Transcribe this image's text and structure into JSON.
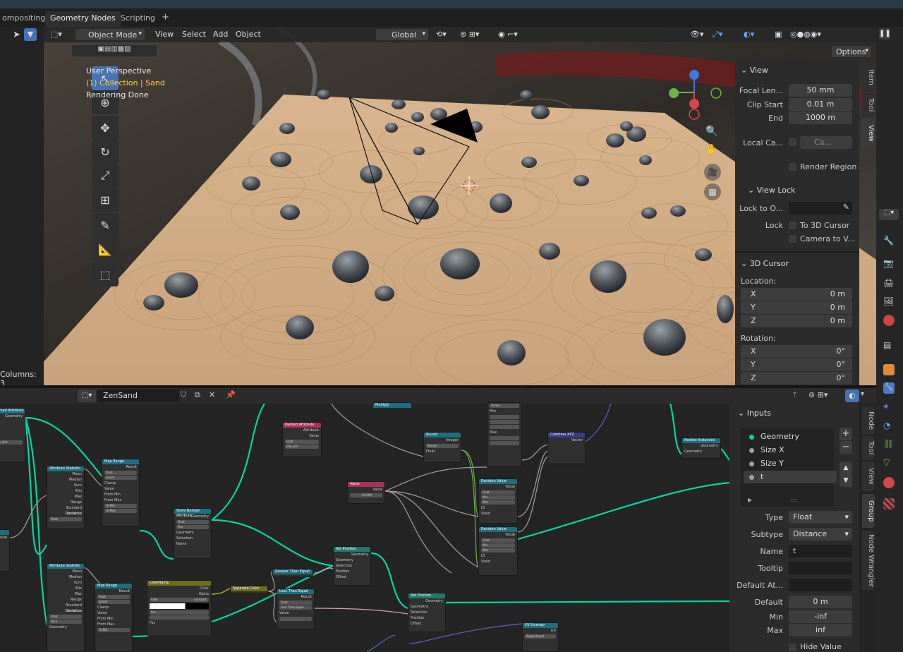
{
  "workspace_tabs": [
    "ompositing",
    "Geometry Nodes",
    "Scripting",
    "+"
  ],
  "viewport": {
    "mode": "Object Mode",
    "menus": [
      "View",
      "Select",
      "Add",
      "Object"
    ],
    "transform_orientation": "Global",
    "options": "Options",
    "overlay_lines": [
      "User Perspective",
      "(1) Collection | Sand",
      "Rendering Done"
    ],
    "columns_label": "Columns: 3"
  },
  "n_panel": {
    "view_header": "View",
    "focal_length": {
      "label": "Focal Len...",
      "value": "50 mm"
    },
    "clip_start": {
      "label": "Clip Start",
      "value": "0.01 m"
    },
    "clip_end": {
      "label": "End",
      "value": "1000 m"
    },
    "local_camera": {
      "label": "Local Ca...",
      "value": "Ca..."
    },
    "render_region": "Render Region",
    "view_lock_header": "View Lock",
    "lock_to_object": "Lock to O...",
    "lock": "Lock",
    "to_3d_cursor": "To 3D Cursor",
    "camera_to_view": "Camera to V...",
    "cursor_header": "3D Cursor",
    "location_label": "Location:",
    "location": [
      {
        "axis": "X",
        "value": "0 m"
      },
      {
        "axis": "Y",
        "value": "0 m"
      },
      {
        "axis": "Z",
        "value": "0 m"
      }
    ],
    "rotation_label": "Rotation:",
    "rotation": [
      {
        "axis": "X",
        "value": "0°"
      },
      {
        "axis": "Y",
        "value": "0°"
      },
      {
        "axis": "Z",
        "value": "0°"
      }
    ],
    "tabs": [
      "Item",
      "Tool",
      "View"
    ]
  },
  "node_editor": {
    "tree_name": "ZenSand",
    "tabs": [
      "Node",
      "Tool",
      "View",
      "Group",
      "Node Wrangler"
    ],
    "group_panel": {
      "header": "Inputs",
      "inputs": [
        {
          "name": "Geometry",
          "color": "#00d6a3"
        },
        {
          "name": "Size X",
          "color": "#a1a1a1"
        },
        {
          "name": "Size Y",
          "color": "#a1a1a1"
        },
        {
          "name": "t",
          "color": "#a1a1a1"
        }
      ],
      "type": {
        "label": "Type",
        "value": "Float"
      },
      "subtype": {
        "label": "Subtype",
        "value": "Distance"
      },
      "name": {
        "label": "Name",
        "value": "t"
      },
      "tooltip": {
        "label": "Tooltip",
        "value": ""
      },
      "default_attr": {
        "label": "Default At...",
        "value": ""
      },
      "default": {
        "label": "Default",
        "value": "0 m"
      },
      "min": {
        "label": "Min",
        "value": "-inf"
      },
      "max": {
        "label": "Max",
        "value": "inf"
      },
      "hide_value": "Hide Value"
    },
    "nodes": {
      "map_range": "Map Range",
      "attribute_statistic": "Attribute Statistic",
      "store_named_attribute": "Store Named Attribute",
      "named_attribute": "Named Attribute",
      "value": "Value",
      "value_amount": "40.000",
      "set_position": "Set Position",
      "round": "Round",
      "random_value": "Random Value",
      "combine_xyz": "Combine XYZ",
      "realize_instances": "Realize Instances",
      "color_ramp": "ColorRamp",
      "separate_color": "Separate Color",
      "greater_than": "Greater Than Equal",
      "less_than": "Less Than Equal",
      "multiply": "Multiply",
      "uv_unwrap": "UV Unwrap",
      "vector": "Vector",
      "labels": {
        "geometry": "Geometry",
        "result": "Result",
        "float": "Float",
        "linear": "Linear",
        "clamp": "Clamp",
        "selection": "Selection",
        "name": "Name",
        "position": "Position",
        "offset": "Offset",
        "value_lbl": "Value",
        "attribute": "Attribute",
        "round_lbl": "Round",
        "integer": "Integer",
        "min": "Min",
        "max": "Max",
        "seed": "Seed",
        "id": "ID",
        "color": "Color",
        "alpha": "Alpha",
        "rgb": "RGB",
        "constant": "Constant",
        "fac": "Fac",
        "pos": "Pos",
        "face": "Face",
        "mean": "Mean",
        "median": "Median",
        "sum": "Sum",
        "range": "Range",
        "std_dev": "Standard Deviation",
        "variance": "Variance",
        "from_min": "From Min",
        "from_max": "From Max",
        "to_min": "To Min",
        "to_max": "To Max",
        "angle_based": "Angle Based",
        "uv": "UV",
        "vector_out": "Vector",
        "sand_dist": "sdk_dist"
      }
    }
  }
}
